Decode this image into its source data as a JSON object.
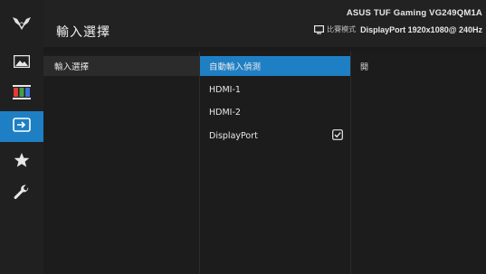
{
  "header": {
    "title": "輸入選擇",
    "model": "ASUS TUF Gaming  VG249QM1A",
    "mode_label": "比賽模式",
    "signal": "DisplayPort  1920x1080@ 240Hz"
  },
  "sidebar": {
    "items": [
      {
        "icon": "tuf-logo-icon"
      },
      {
        "icon": "image-icon"
      },
      {
        "icon": "color-icon"
      },
      {
        "icon": "input-select-icon",
        "active": true
      },
      {
        "icon": "star-icon"
      },
      {
        "icon": "wrench-icon"
      }
    ]
  },
  "main_menu": {
    "items": [
      {
        "label": "輸入選擇",
        "selected": true
      }
    ]
  },
  "sub_menu": {
    "items": [
      {
        "label": "自動輸入偵測",
        "highlighted": true
      },
      {
        "label": "HDMI-1"
      },
      {
        "label": "HDMI-2"
      },
      {
        "label": "DisplayPort",
        "checked": true
      }
    ]
  },
  "value_panel": {
    "value": "開"
  },
  "colors": {
    "accent": "#1f7fc4",
    "background": "#1a1a1a"
  }
}
